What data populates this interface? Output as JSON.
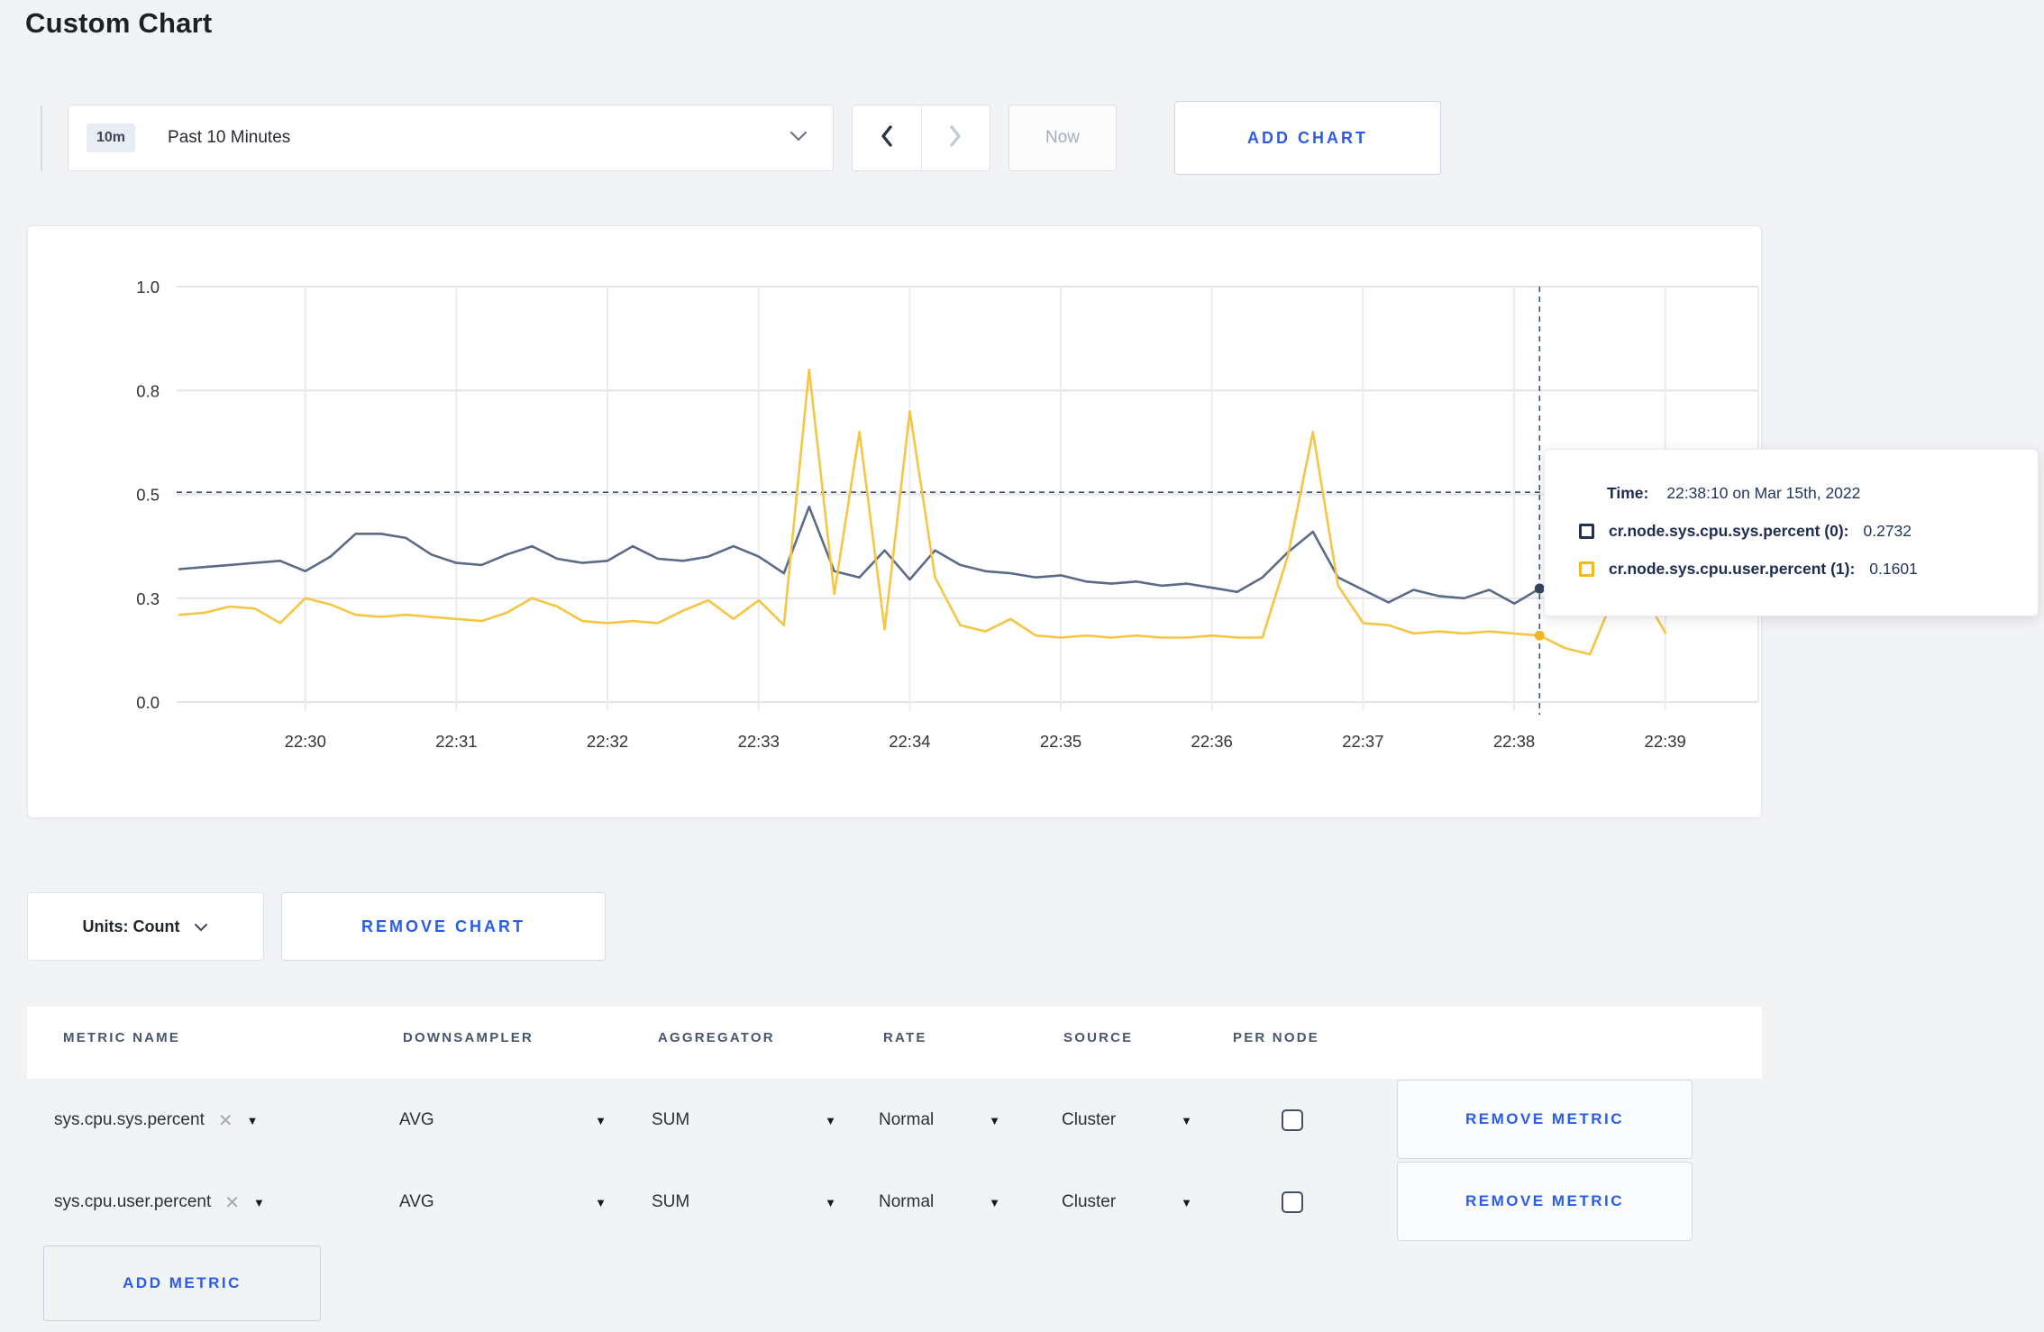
{
  "page": {
    "title": "Custom Chart",
    "background": "#f2f3f5",
    "accent_blue": "#2b5ce8"
  },
  "toolbar": {
    "range_badge": "10m",
    "range_label": "Past 10 Minutes",
    "now_label": "Now",
    "add_chart_label": "ADD CHART"
  },
  "chart_data": {
    "type": "line",
    "title": "",
    "xlabel": "",
    "ylabel": "",
    "ylim": [
      0,
      1
    ],
    "grid": true,
    "start_time": "22:29:10",
    "interval_sec": 10,
    "x_tick_labels": [
      "22:30",
      "22:31",
      "22:32",
      "22:33",
      "22:34",
      "22:35",
      "22:36",
      "22:37",
      "22:38",
      "22:39"
    ],
    "y_ticks": [
      {
        "label": "0.0",
        "value": 0
      },
      {
        "label": "0.3",
        "value": 0.25
      },
      {
        "label": "0.5",
        "value": 0.5
      },
      {
        "label": "0.8",
        "value": 0.75
      },
      {
        "label": "1.0",
        "value": 1
      }
    ],
    "series": [
      {
        "name": "cr.node.sys.cpu.sys.percent",
        "color": "#5b6b86",
        "marker_color": "#36435f",
        "values": [
          0.32,
          0.325,
          0.33,
          0.335,
          0.34,
          0.315,
          0.35,
          0.405,
          0.405,
          0.395,
          0.355,
          0.335,
          0.33,
          0.355,
          0.375,
          0.345,
          0.335,
          0.34,
          0.375,
          0.345,
          0.34,
          0.35,
          0.375,
          0.35,
          0.31,
          0.47,
          0.315,
          0.3,
          0.365,
          0.295,
          0.365,
          0.33,
          0.315,
          0.31,
          0.3,
          0.305,
          0.29,
          0.285,
          0.29,
          0.28,
          0.285,
          0.275,
          0.265,
          0.3,
          0.36,
          0.41,
          0.3,
          0.27,
          0.24,
          0.27,
          0.255,
          0.25,
          0.27,
          0.237,
          0.2732,
          0.25,
          0.26,
          0.27,
          0.265,
          0.27
        ]
      },
      {
        "name": "cr.node.sys.cpu.user.percent",
        "color": "#f6c544",
        "marker_color": "#f2b824",
        "values": [
          0.21,
          0.215,
          0.23,
          0.225,
          0.19,
          0.25,
          0.235,
          0.21,
          0.205,
          0.21,
          0.205,
          0.2,
          0.195,
          0.215,
          0.25,
          0.23,
          0.195,
          0.19,
          0.195,
          0.19,
          0.22,
          0.245,
          0.2,
          0.245,
          0.185,
          0.8,
          0.26,
          0.65,
          0.175,
          0.7,
          0.3,
          0.185,
          0.17,
          0.2,
          0.16,
          0.155,
          0.16,
          0.155,
          0.16,
          0.155,
          0.155,
          0.16,
          0.155,
          0.155,
          0.35,
          0.65,
          0.28,
          0.19,
          0.185,
          0.165,
          0.17,
          0.165,
          0.17,
          0.165,
          0.1601,
          0.13,
          0.115,
          0.26,
          0.27,
          0.167
        ]
      }
    ],
    "crosshair": {
      "index": 54,
      "y_value": 0.505,
      "time": "22:38:10"
    },
    "legend_position": "tooltip"
  },
  "tooltip": {
    "time_label": "Time:",
    "time_value": "22:38:10 on Mar 15th, 2022",
    "rows": [
      {
        "label": "cr.node.sys.cpu.sys.percent (0):",
        "value": "0.2732",
        "swatch_color": "#25304e"
      },
      {
        "label": "cr.node.sys.cpu.user.percent (1):",
        "value": "0.1601",
        "swatch_color": "#f5b81f"
      }
    ]
  },
  "units_row": {
    "units_label": "Units: Count",
    "remove_chart_label": "REMOVE CHART"
  },
  "table": {
    "headers": [
      "METRIC NAME",
      "DOWNSAMPLER",
      "AGGREGATOR",
      "RATE",
      "SOURCE",
      "PER NODE"
    ],
    "rows": [
      {
        "metric": "sys.cpu.sys.percent",
        "downsampler": "AVG",
        "aggregator": "SUM",
        "rate": "Normal",
        "source": "Cluster",
        "per_node_checked": false,
        "remove_label": "REMOVE METRIC"
      },
      {
        "metric": "sys.cpu.user.percent",
        "downsampler": "AVG",
        "aggregator": "SUM",
        "rate": "Normal",
        "source": "Cluster",
        "per_node_checked": false,
        "remove_label": "REMOVE METRIC"
      }
    ],
    "add_metric_label": "ADD METRIC"
  }
}
